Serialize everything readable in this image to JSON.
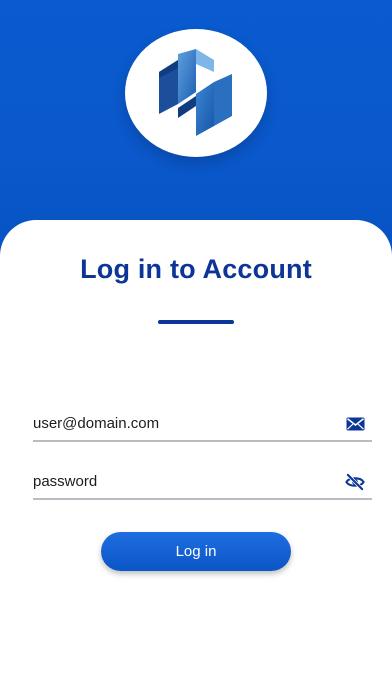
{
  "header": {
    "logo_icon": "app-logo-icon",
    "background_color": "#0a5bd0"
  },
  "login": {
    "title": "Log in to Account",
    "email_field": {
      "value": "user@domain.com",
      "icon": "envelope-icon"
    },
    "password_field": {
      "value": "password",
      "icon": "eye-slash-icon"
    },
    "submit_label": "Log in"
  },
  "colors": {
    "accent": "#0c3597",
    "button": "#1163d6",
    "underline": "#b9bcc2"
  }
}
